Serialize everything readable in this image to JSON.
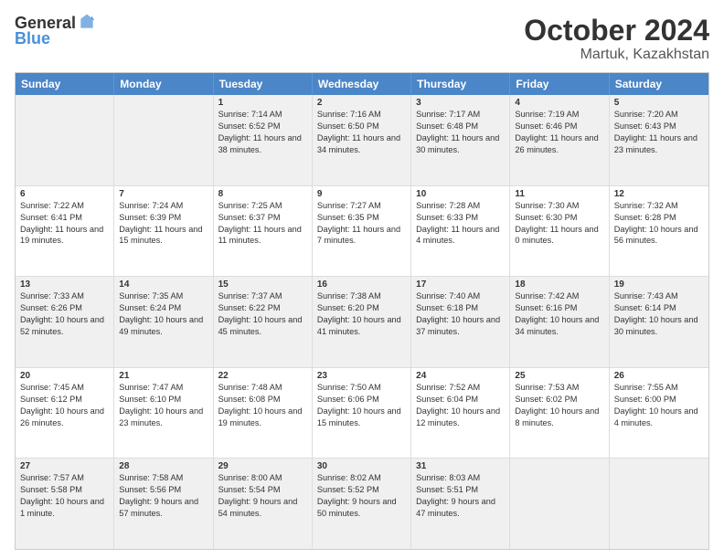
{
  "logo": {
    "line1": "General",
    "line2": "Blue"
  },
  "title": "October 2024",
  "subtitle": "Martuk, Kazakhstan",
  "days": [
    "Sunday",
    "Monday",
    "Tuesday",
    "Wednesday",
    "Thursday",
    "Friday",
    "Saturday"
  ],
  "weeks": [
    [
      {
        "day": "",
        "info": ""
      },
      {
        "day": "",
        "info": ""
      },
      {
        "day": "1",
        "info": "Sunrise: 7:14 AM\nSunset: 6:52 PM\nDaylight: 11 hours and 38 minutes."
      },
      {
        "day": "2",
        "info": "Sunrise: 7:16 AM\nSunset: 6:50 PM\nDaylight: 11 hours and 34 minutes."
      },
      {
        "day": "3",
        "info": "Sunrise: 7:17 AM\nSunset: 6:48 PM\nDaylight: 11 hours and 30 minutes."
      },
      {
        "day": "4",
        "info": "Sunrise: 7:19 AM\nSunset: 6:46 PM\nDaylight: 11 hours and 26 minutes."
      },
      {
        "day": "5",
        "info": "Sunrise: 7:20 AM\nSunset: 6:43 PM\nDaylight: 11 hours and 23 minutes."
      }
    ],
    [
      {
        "day": "6",
        "info": "Sunrise: 7:22 AM\nSunset: 6:41 PM\nDaylight: 11 hours and 19 minutes."
      },
      {
        "day": "7",
        "info": "Sunrise: 7:24 AM\nSunset: 6:39 PM\nDaylight: 11 hours and 15 minutes."
      },
      {
        "day": "8",
        "info": "Sunrise: 7:25 AM\nSunset: 6:37 PM\nDaylight: 11 hours and 11 minutes."
      },
      {
        "day": "9",
        "info": "Sunrise: 7:27 AM\nSunset: 6:35 PM\nDaylight: 11 hours and 7 minutes."
      },
      {
        "day": "10",
        "info": "Sunrise: 7:28 AM\nSunset: 6:33 PM\nDaylight: 11 hours and 4 minutes."
      },
      {
        "day": "11",
        "info": "Sunrise: 7:30 AM\nSunset: 6:30 PM\nDaylight: 11 hours and 0 minutes."
      },
      {
        "day": "12",
        "info": "Sunrise: 7:32 AM\nSunset: 6:28 PM\nDaylight: 10 hours and 56 minutes."
      }
    ],
    [
      {
        "day": "13",
        "info": "Sunrise: 7:33 AM\nSunset: 6:26 PM\nDaylight: 10 hours and 52 minutes."
      },
      {
        "day": "14",
        "info": "Sunrise: 7:35 AM\nSunset: 6:24 PM\nDaylight: 10 hours and 49 minutes."
      },
      {
        "day": "15",
        "info": "Sunrise: 7:37 AM\nSunset: 6:22 PM\nDaylight: 10 hours and 45 minutes."
      },
      {
        "day": "16",
        "info": "Sunrise: 7:38 AM\nSunset: 6:20 PM\nDaylight: 10 hours and 41 minutes."
      },
      {
        "day": "17",
        "info": "Sunrise: 7:40 AM\nSunset: 6:18 PM\nDaylight: 10 hours and 37 minutes."
      },
      {
        "day": "18",
        "info": "Sunrise: 7:42 AM\nSunset: 6:16 PM\nDaylight: 10 hours and 34 minutes."
      },
      {
        "day": "19",
        "info": "Sunrise: 7:43 AM\nSunset: 6:14 PM\nDaylight: 10 hours and 30 minutes."
      }
    ],
    [
      {
        "day": "20",
        "info": "Sunrise: 7:45 AM\nSunset: 6:12 PM\nDaylight: 10 hours and 26 minutes."
      },
      {
        "day": "21",
        "info": "Sunrise: 7:47 AM\nSunset: 6:10 PM\nDaylight: 10 hours and 23 minutes."
      },
      {
        "day": "22",
        "info": "Sunrise: 7:48 AM\nSunset: 6:08 PM\nDaylight: 10 hours and 19 minutes."
      },
      {
        "day": "23",
        "info": "Sunrise: 7:50 AM\nSunset: 6:06 PM\nDaylight: 10 hours and 15 minutes."
      },
      {
        "day": "24",
        "info": "Sunrise: 7:52 AM\nSunset: 6:04 PM\nDaylight: 10 hours and 12 minutes."
      },
      {
        "day": "25",
        "info": "Sunrise: 7:53 AM\nSunset: 6:02 PM\nDaylight: 10 hours and 8 minutes."
      },
      {
        "day": "26",
        "info": "Sunrise: 7:55 AM\nSunset: 6:00 PM\nDaylight: 10 hours and 4 minutes."
      }
    ],
    [
      {
        "day": "27",
        "info": "Sunrise: 7:57 AM\nSunset: 5:58 PM\nDaylight: 10 hours and 1 minute."
      },
      {
        "day": "28",
        "info": "Sunrise: 7:58 AM\nSunset: 5:56 PM\nDaylight: 9 hours and 57 minutes."
      },
      {
        "day": "29",
        "info": "Sunrise: 8:00 AM\nSunset: 5:54 PM\nDaylight: 9 hours and 54 minutes."
      },
      {
        "day": "30",
        "info": "Sunrise: 8:02 AM\nSunset: 5:52 PM\nDaylight: 9 hours and 50 minutes."
      },
      {
        "day": "31",
        "info": "Sunrise: 8:03 AM\nSunset: 5:51 PM\nDaylight: 9 hours and 47 minutes."
      },
      {
        "day": "",
        "info": ""
      },
      {
        "day": "",
        "info": ""
      }
    ]
  ]
}
